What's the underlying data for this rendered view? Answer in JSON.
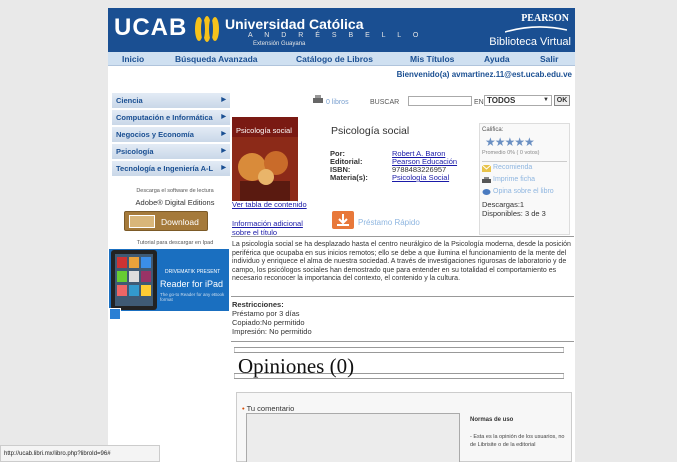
{
  "header": {
    "logo": "UCAB",
    "university": "Universidad Católica",
    "andres_bello": "A N D R É S   B E L L O",
    "extension": "Extensión Guayana",
    "pearson": "PEARSON",
    "biblioteca": "Biblioteca Virtual"
  },
  "nav": [
    "Inicio",
    "Búsqueda Avanzada",
    "Catálogo de Libros",
    "Mis Títulos",
    "Ayuda",
    "Salir"
  ],
  "welcome": "Bienvenido(a) avmartinez.11@est.ucab.edu.ve",
  "sidebar": {
    "categories": [
      "Ciencia",
      "Computación e Informática",
      "Negocios y Economía",
      "Psicología",
      "Tecnología e Ingeniería A-L"
    ],
    "adobe_text": "Descarga el software de lectura",
    "adobe_title": "Adobe® Digital Editions",
    "download": "Download",
    "tutorial": "Tutorial para descargar en Ipad",
    "ipad_title": "DRIVEMATIK PRESENT",
    "ipad_big": "Reader for iPad",
    "ipad_small": "The go-to Reader for any eBook format"
  },
  "search": {
    "libros": "0 libros",
    "buscar": "BUSCAR",
    "en": "EN",
    "select": "TODOS",
    "ok": "OK"
  },
  "book": {
    "cover_title": "Psicología social",
    "title": "Psicología social",
    "labels": [
      "Por:",
      "Editorial:",
      "ISBN:",
      "Materia(s):"
    ],
    "author": "Robert A. Baron",
    "editorial": "Pearson Educación",
    "isbn": "9788483226957",
    "materia": "Psicología Social",
    "tabla": "Ver tabla de contenido",
    "info_1": "Información adicional",
    "info_2": "sobre el título",
    "prestamo": "Préstamo Rápido",
    "description": "La psicología social se ha desplazado hasta el centro neurálgico de la Psicología moderna, desde la posición periférica que ocupaba en sus inicios remotos; ello se debe a que ilumina el funcionamiento de la mente del individuo y enriquece el alma de nuestra sociedad. A través de investigaciones rigurosas de laboratorio y de campo, los psicólogos sociales han demostrado que para entender en su totalidad el comportamiento es necesario reconocer la importancia del contexto, el contenido y la cultura.",
    "restricciones_title": "Restricciones:",
    "restricciones": [
      "Préstamo por 3 días",
      "Copiado:No permitido",
      "Impresión: No permitido"
    ]
  },
  "rating": {
    "califica": "Califica:",
    "stars": "★★★★★",
    "promedio": "Promedio 0% ( 0 votos)",
    "recomienda": "Recomienda",
    "imprime": "Imprime ficha",
    "opina": "Opina sobre el libro",
    "descargas": "Descargas:1",
    "disponibles": "Disponibles: 3 de 3"
  },
  "opiniones": {
    "title": "Opiniones (0)",
    "comment_label": "Tu comentario",
    "normas_title": "Normas de uso",
    "normas_text": "- Esta es la opinión de los usuarios, no de Librisite o de la editorial"
  },
  "statusbar": "http://ucab.libri.mx/libro.php?libroId=96#",
  "colors": {
    "brand_blue": "#1a4f92",
    "nav_bg": "#cfe0f1",
    "download_brown": "#a57a3b",
    "cover_red": "#7a1a13"
  }
}
